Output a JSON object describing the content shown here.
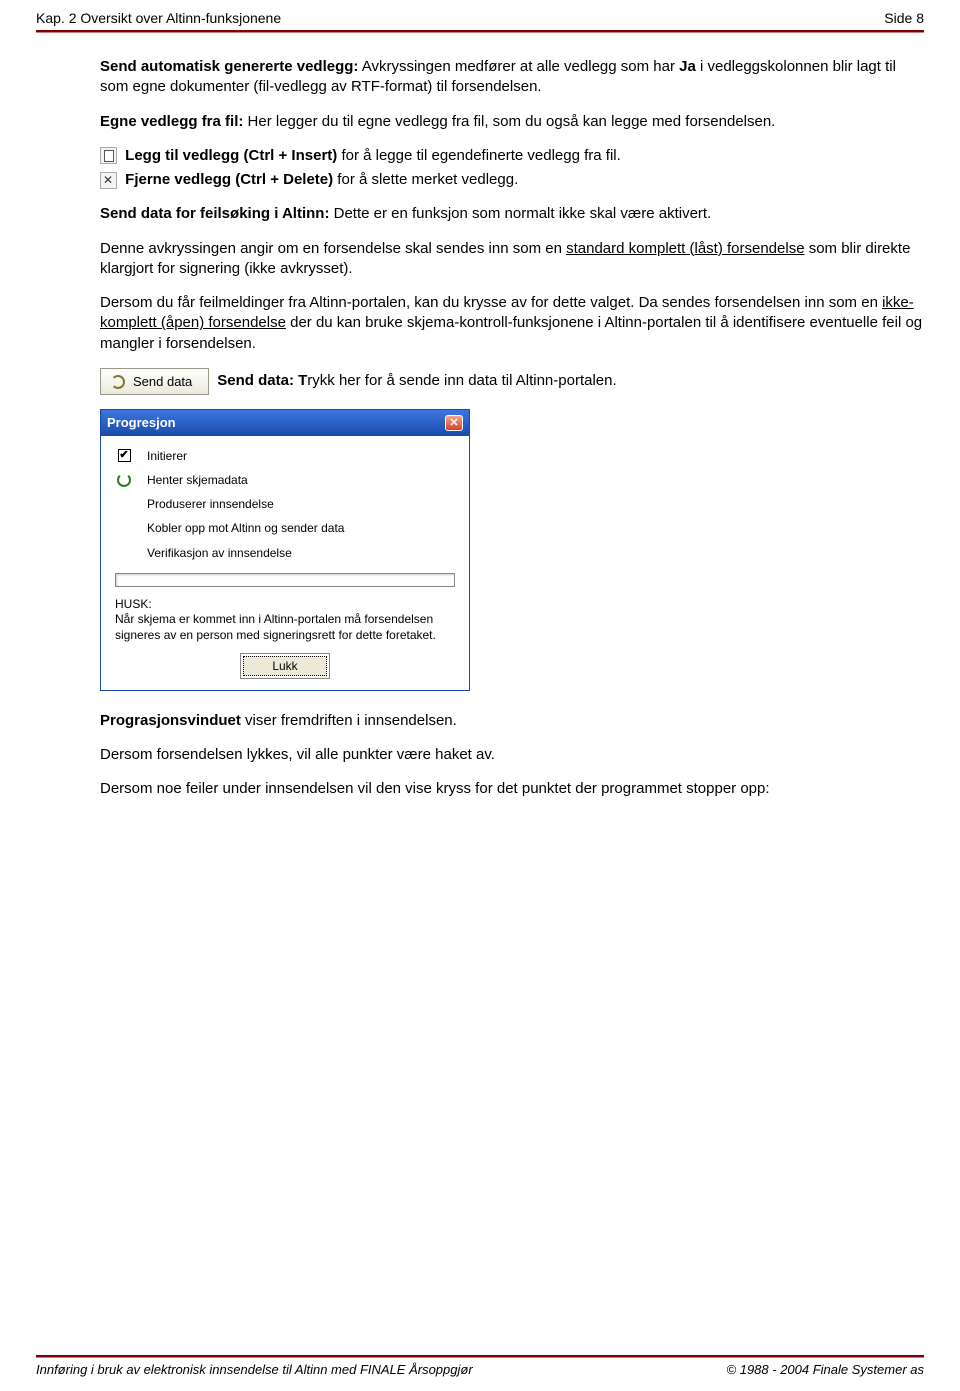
{
  "header": {
    "left": "Kap. 2 Oversikt over Altinn-funksjonene",
    "right": "Side 8"
  },
  "p1a": "Send automatisk genererte vedlegg:",
  "p1b": " Avkryssingen medfører at alle vedlegg som har ",
  "p1c": "Ja",
  "p1d": " i vedleggskolonnen blir lagt til som egne dokumenter (fil-vedlegg av RTF-format) til forsendelsen.",
  "p2a": "Egne vedlegg fra fil:",
  "p2b": " Her legger du til egne vedlegg fra fil, som du også kan legge med forsendelsen.",
  "p3a": " Legg til vedlegg (Ctrl + Insert)",
  "p3b": " for å legge til egendefinerte vedlegg fra fil.",
  "p4a": " Fjerne vedlegg (Ctrl + Delete)",
  "p4b": " for å slette merket vedlegg.",
  "p5a": "Send data for feilsøking i Altinn:",
  "p5b": " Dette er en funksjon som normalt ikke skal være aktivert.",
  "p6a": "Denne avkryssingen angir om en forsendelse skal sendes inn som en ",
  "p6b": "standard komplett (låst) forsendelse",
  "p6c": " som blir direkte klargjort for signering (ikke avkrysset).",
  "p7a": "Dersom du får feilmeldinger fra Altinn-portalen, kan du krysse av for dette valget. Da sendes forsendelsen inn som en ",
  "p7b": "ikke-komplett (åpen) forsendelse",
  "p7c": " der du kan bruke skjema-kontroll-funksjonene i Altinn-portalen til å identifisere eventuelle feil og mangler i forsendelsen.",
  "sendBtn": "Send data",
  "p8a": "Send data: T",
  "p8b": "rykk her for å sende inn data til Altinn-portalen.",
  "prog": {
    "title": "Progresjon",
    "items": [
      "Initierer",
      "Henter skjemadata",
      "Produserer innsendelse",
      "Kobler opp mot Altinn og sender data",
      "Verifikasjon av innsendelse"
    ],
    "huskHead": "HUSK:",
    "huskBody": "Når skjema er kommet inn i Altinn-portalen må forsendelsen signeres av en person med signeringsrett for dette foretaket.",
    "lukk": "Lukk"
  },
  "p9a": "Prograsjonsvinduet",
  "p9b": " viser fremdriften i innsendelsen.",
  "p10": "Dersom forsendelsen lykkes, vil alle punkter være haket av.",
  "p11": "Dersom noe feiler under innsendelsen vil den vise kryss for det punktet der programmet stopper opp:",
  "footer": {
    "left": "Innføring i bruk av elektronisk innsendelse til Altinn med FINALE Årsoppgjør",
    "right": "© 1988 - 2004 Finale Systemer as"
  }
}
